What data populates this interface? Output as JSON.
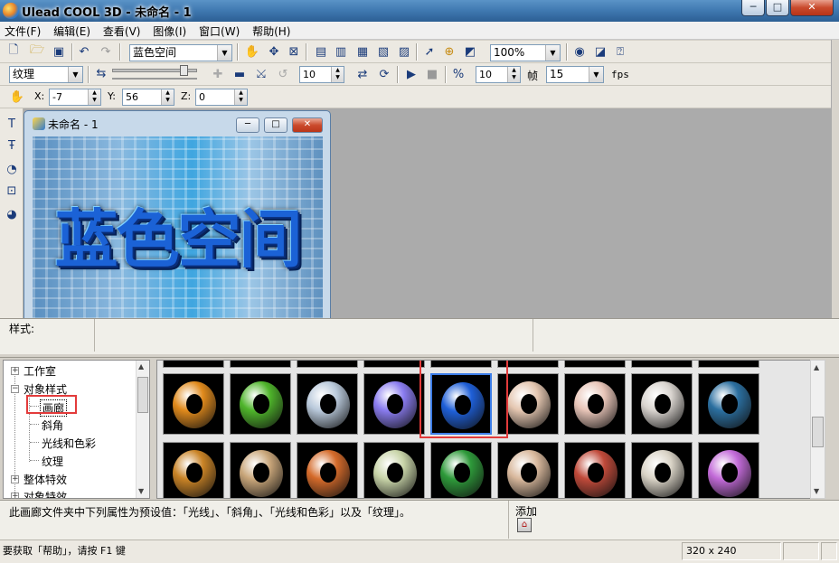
{
  "window": {
    "title": "Ulead COOL 3D - 未命名 - 1",
    "min_glyph": "─",
    "max_glyph": "□",
    "close_glyph": "✕"
  },
  "menu": [
    "文件(F)",
    "编辑(E)",
    "查看(V)",
    "图像(I)",
    "窗口(W)",
    "帮助(H)"
  ],
  "toolbar1": {
    "text_combo": "蓝色空间",
    "zoom_combo": "100%"
  },
  "toolbar2": {
    "attr_combo": "纹理",
    "spin_a": "10",
    "spin_frame": "10",
    "frame_label": "帧",
    "fps_value": "15",
    "fps_label": "fps"
  },
  "toolbar3": {
    "x_label": "X:",
    "x_value": "-7",
    "y_label": "Y:",
    "y_value": "56",
    "z_label": "Z:",
    "z_value": "0"
  },
  "child_window": {
    "title": "未命名 - 1",
    "art_text": "蓝色空间"
  },
  "stylebar": {
    "label": "样式:"
  },
  "tree": {
    "items": [
      "工作室",
      "对象样式",
      "画廊",
      "斜角",
      "光线和色彩",
      "纹理",
      "整体特效",
      "对象特效"
    ]
  },
  "infobar": {
    "description": "此画廊文件夹中下列属性为预设值：「光线」、「斜角」、「光线和色彩」以及「纹理」。",
    "add_label": "添加"
  },
  "statusbar": {
    "help_text": "要获取「帮助」，请按 F1 键",
    "size_text": "320 x 240"
  },
  "thumbs_row1": [
    "#e08a1c",
    "#4fb52b",
    "#b9c9db",
    "#8a7cf0",
    "#1e5fd8",
    "#e4c6b0",
    "#e8c5b8",
    "#d9d4cf",
    "#2b6fa0"
  ],
  "thumbs_row2": [
    "#c98326",
    "#c9a67a",
    "#d46a2a",
    "#c8d4a8",
    "#2e9a3a",
    "#d8b89c",
    "#c04a3a",
    "#d9d3c6",
    "#c26ad8"
  ],
  "colors": {
    "selection": "#1b62d6",
    "highlight": "#e33b3b"
  }
}
